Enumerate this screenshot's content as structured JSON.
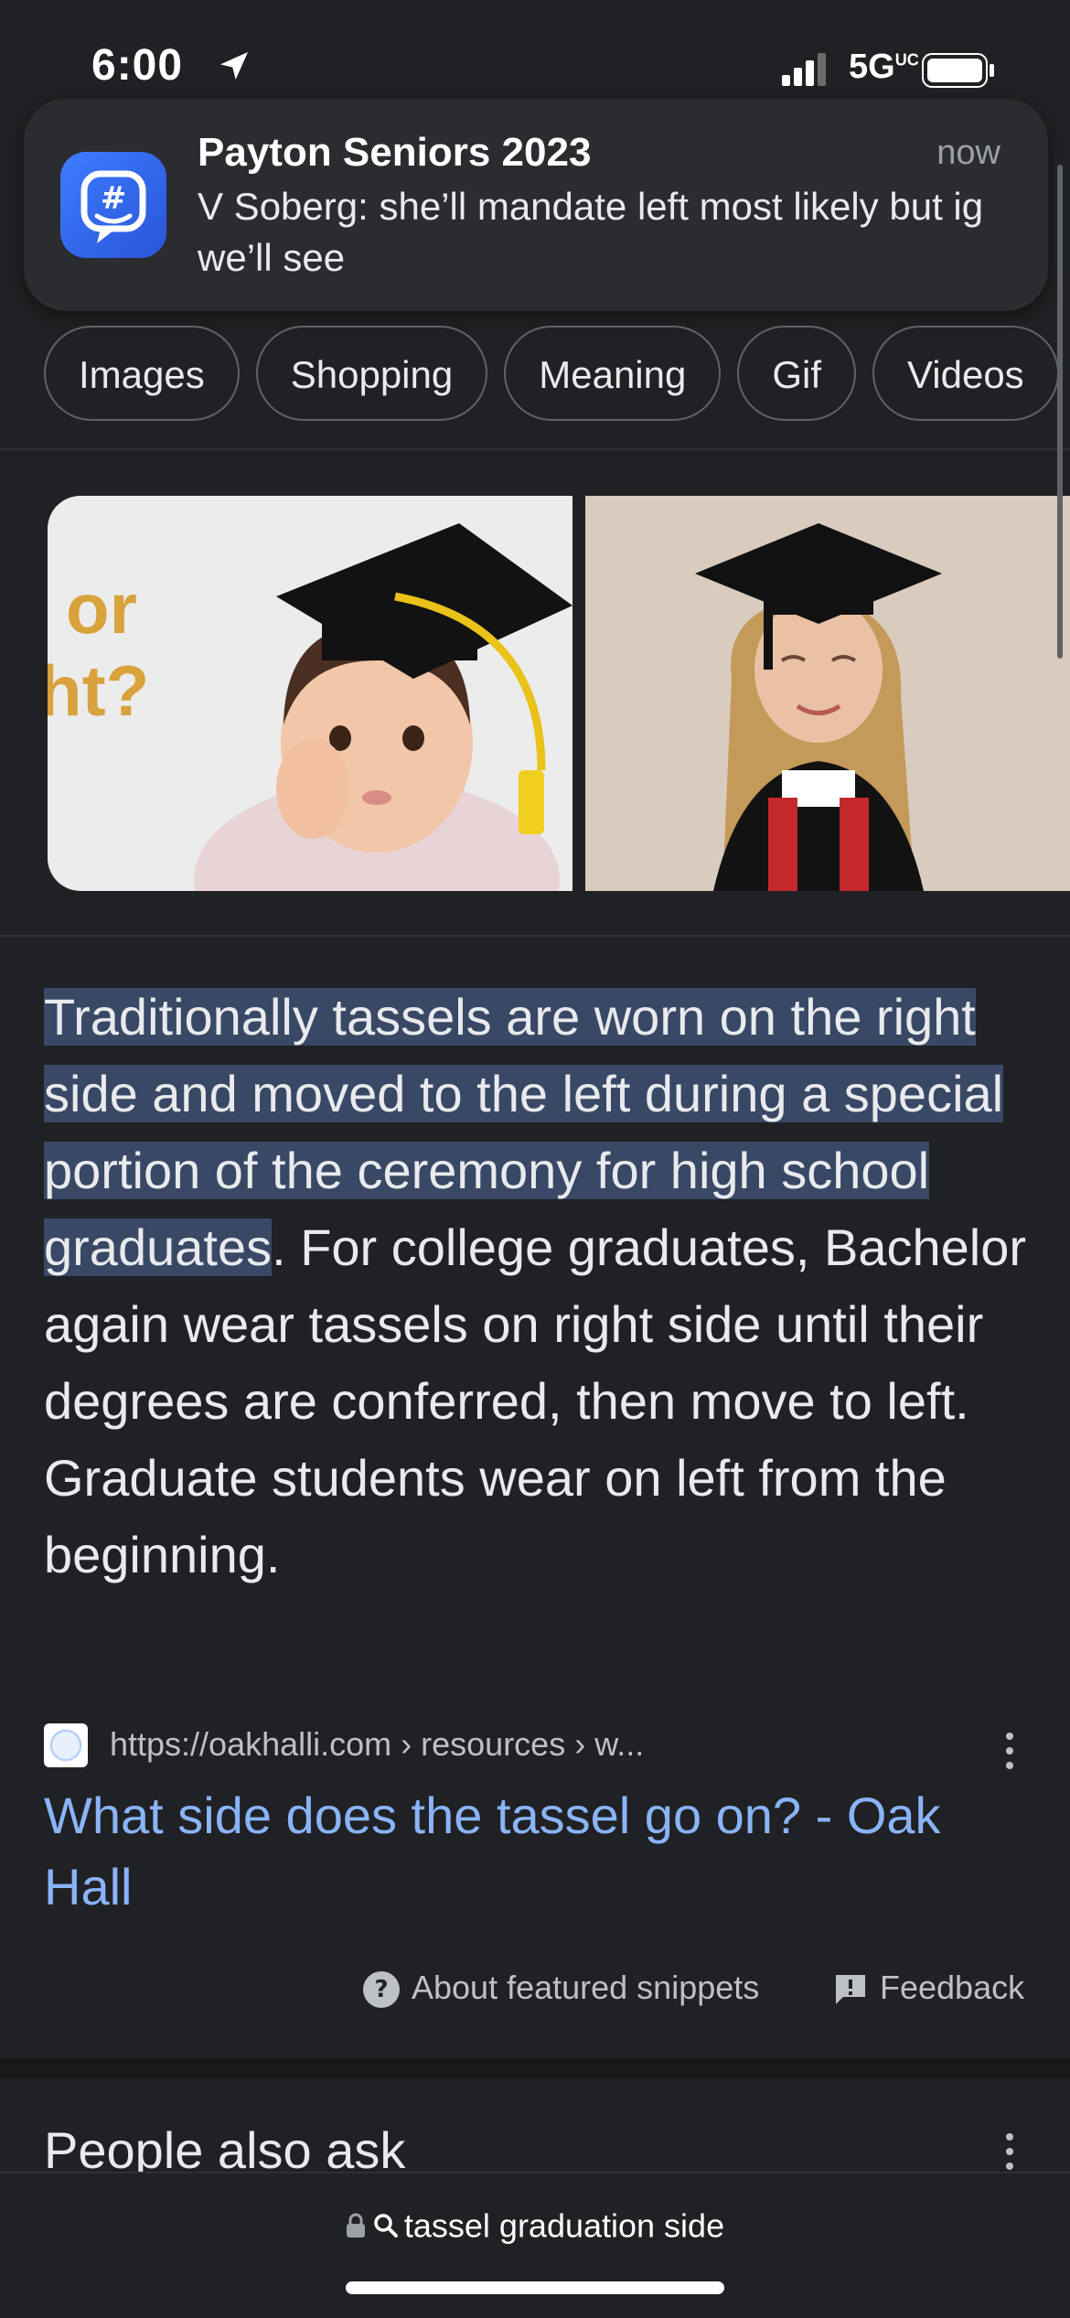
{
  "status_bar": {
    "time": "6:00",
    "network": "5G",
    "network_suffix": "UC"
  },
  "notification": {
    "title": "Payton Seniors 2023",
    "time": "now",
    "body": "V Soberg: she’ll mandate left most likely but ig we’ll see",
    "app_icon": "groupme-icon"
  },
  "chips": [
    "Images",
    "Shopping",
    "Meaning",
    "Gif",
    "Videos"
  ],
  "images": {
    "img1_overlay_text": [
      "or",
      "ht?"
    ]
  },
  "snippet": {
    "highlighted": "Traditionally tassels are worn on the right side and moved to the left during a special portion of the ceremony for high school graduates",
    "rest": ". For college graduates, Bachelor again wear tassels on right side until their degrees are conferred, then move to left. Graduate students wear on left from the beginning."
  },
  "source": {
    "url": "https://oakhalli.com › resources › w...",
    "title": "What side does the tassel go on? - Oak Hall"
  },
  "footer": {
    "about": "About featured snippets",
    "feedback": "Feedback"
  },
  "people_also_ask": {
    "title": "People also ask"
  },
  "address_bar": {
    "query": "tassel graduation side"
  },
  "colors": {
    "background": "#202124",
    "link": "#8ab4f8",
    "highlight": "#394864"
  }
}
